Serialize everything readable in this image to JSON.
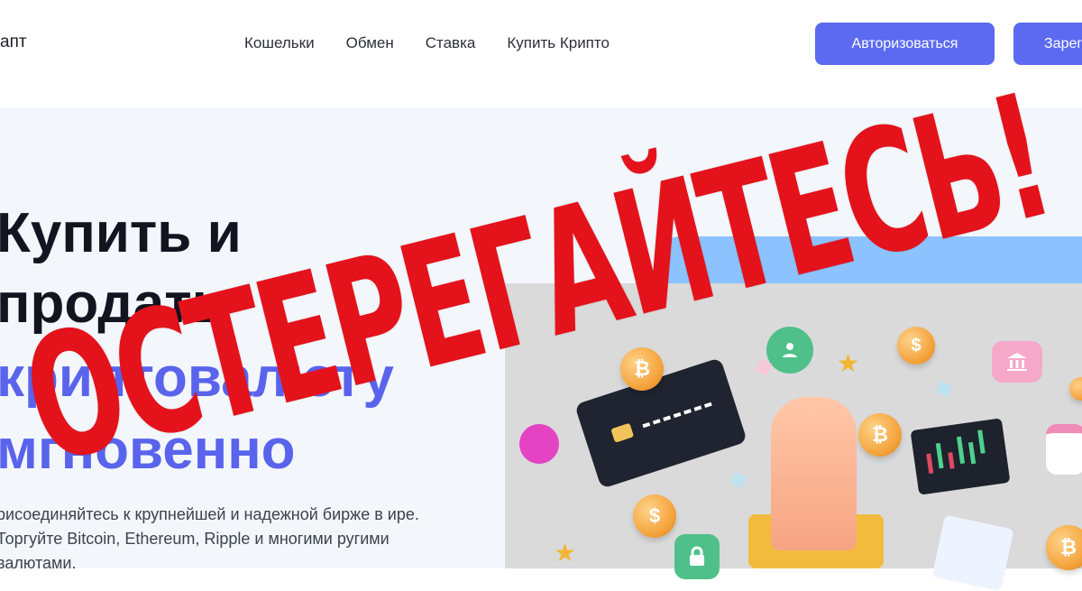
{
  "header": {
    "logo_text": "апт",
    "nav": [
      "Кошельки",
      "Обмен",
      "Ставка",
      "Купить Крипто"
    ],
    "login_label": "Авторизоваться",
    "register_label": "Зарег"
  },
  "hero": {
    "title_line1": "Купить и",
    "title_line2": "продать",
    "title_line3": "криптовалюту",
    "title_line4": "мгновенно",
    "description": "рисоединяйтесь к крупнейшей и надежной бирже в ире. Торгуйте Bitcoin, Ethereum, Ripple и многими ругими валютами."
  },
  "overlay": {
    "warning_text": "ОСТЕРЕГАЙТЕСЬ!",
    "color": "#e4121b"
  },
  "colors": {
    "accent": "#5b6af0",
    "hero_bg": "#f3f7fb"
  }
}
